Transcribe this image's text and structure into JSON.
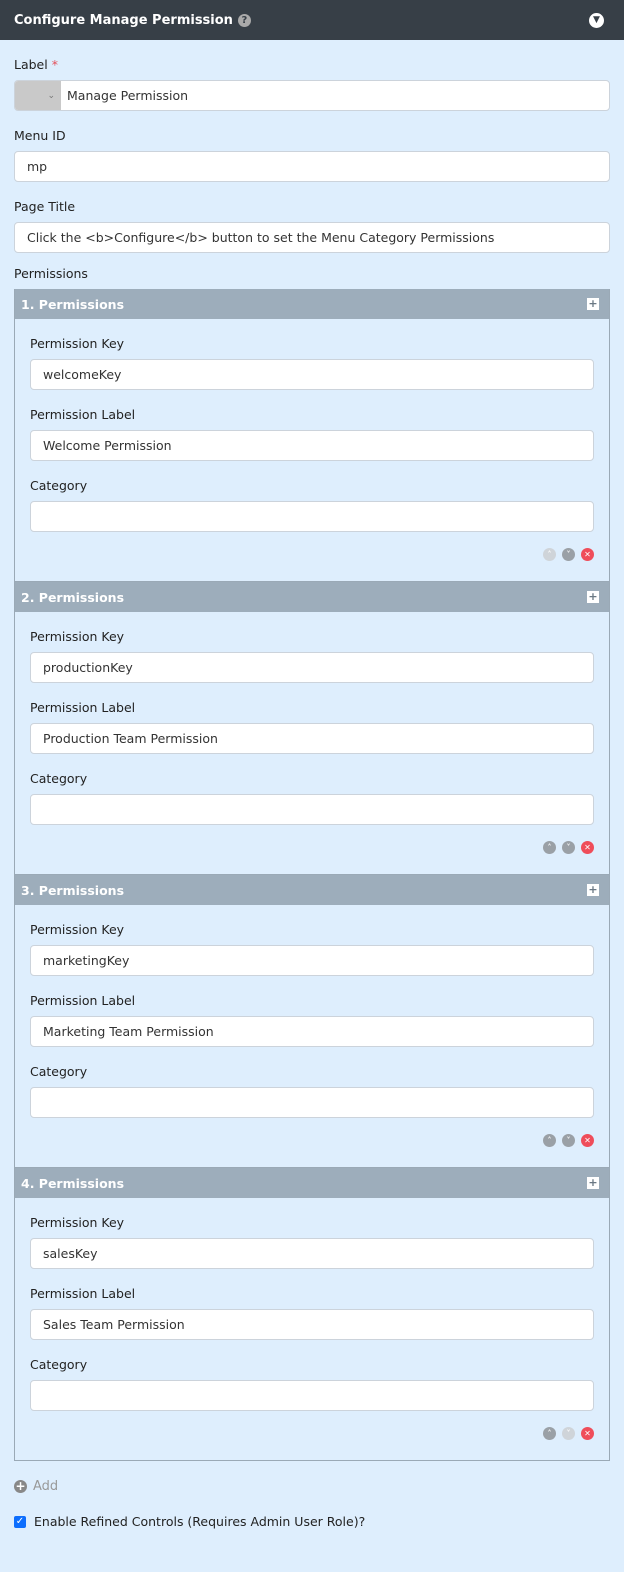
{
  "header": {
    "title": "Configure Manage Permission"
  },
  "label": {
    "label": "Label",
    "required": "*",
    "value": "Manage Permission"
  },
  "menu_id": {
    "label": "Menu ID",
    "value": "mp"
  },
  "page_title": {
    "label": "Page Title",
    "value": "Click the <b>Configure</b> button to set the Menu Category Permissions"
  },
  "permissions": {
    "label": "Permissions",
    "items": [
      {
        "title": "1. Permissions",
        "key_label": "Permission Key",
        "key": "welcomeKey",
        "perm_label": "Permission Label",
        "label": "Welcome Permission",
        "cat_label": "Category",
        "category": ""
      },
      {
        "title": "2. Permissions",
        "key_label": "Permission Key",
        "key": "productionKey",
        "perm_label": "Permission Label",
        "label": "Production Team Permission",
        "cat_label": "Category",
        "category": ""
      },
      {
        "title": "3. Permissions",
        "key_label": "Permission Key",
        "key": "marketingKey",
        "perm_label": "Permission Label",
        "label": "Marketing Team Permission",
        "cat_label": "Category",
        "category": ""
      },
      {
        "title": "4. Permissions",
        "key_label": "Permission Key",
        "key": "salesKey",
        "perm_label": "Permission Label",
        "label": "Sales Team Permission",
        "cat_label": "Category",
        "category": ""
      }
    ]
  },
  "add_label": "Add",
  "refined": {
    "label": "Enable Refined Controls (Requires Admin User Role)?",
    "checked": true
  }
}
